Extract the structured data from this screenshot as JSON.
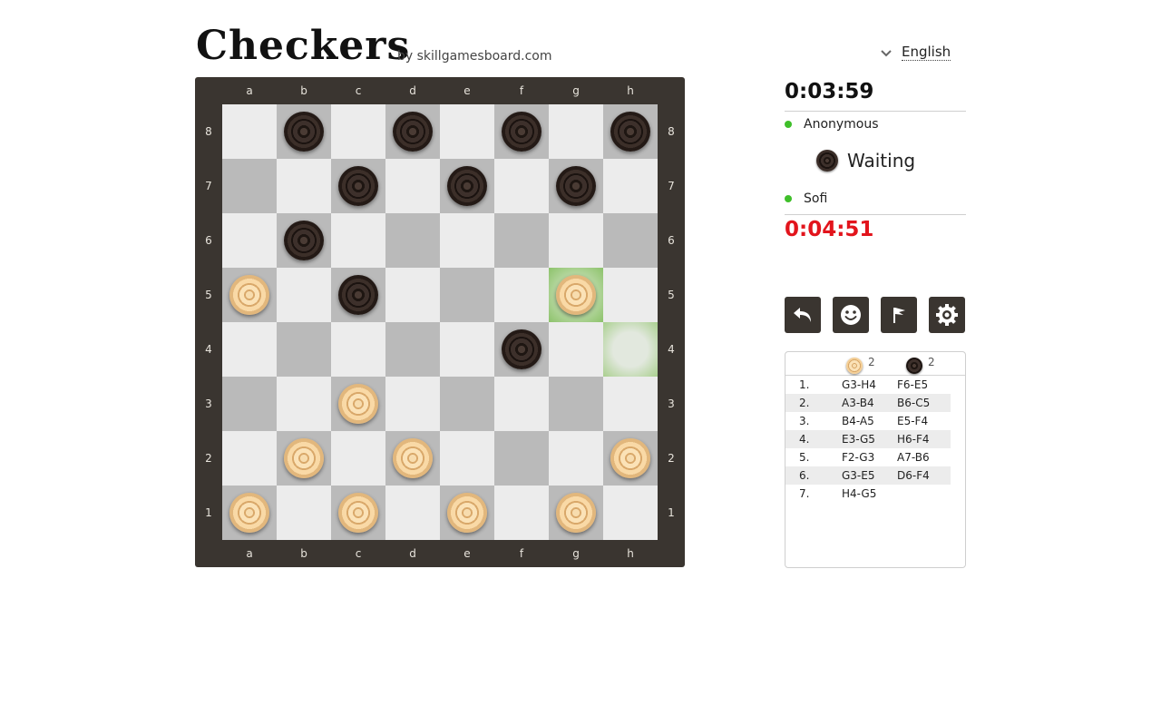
{
  "header": {
    "title": "Checkers",
    "byline": "by skillgamesboard.com",
    "language": "English"
  },
  "board": {
    "files": [
      "a",
      "b",
      "c",
      "d",
      "e",
      "f",
      "g",
      "h"
    ],
    "ranks": [
      "8",
      "7",
      "6",
      "5",
      "4",
      "3",
      "2",
      "1"
    ],
    "black_pieces": [
      "b8",
      "d8",
      "f8",
      "h8",
      "c7",
      "e7",
      "g7",
      "b6",
      "c5",
      "f4"
    ],
    "white_pieces": [
      "a5",
      "g5",
      "c3",
      "b2",
      "d2",
      "h2",
      "a1",
      "c1",
      "e1",
      "g1"
    ],
    "highlighted": [
      "g5",
      "h4"
    ]
  },
  "players": {
    "top": {
      "timer": "0:03:59",
      "name": "Anonymous",
      "status": "Waiting"
    },
    "bottom": {
      "timer": "0:04:51",
      "name": "Sofi"
    }
  },
  "colors": {
    "timer_low": "#e2141c",
    "online": "#3fbf2a",
    "panel_dark": "#3a3530"
  },
  "controls": [
    {
      "icon": "undo-icon"
    },
    {
      "icon": "smiley-icon"
    },
    {
      "icon": "flag-icon"
    },
    {
      "icon": "gear-icon"
    }
  ],
  "score": {
    "white": "2",
    "black": "2"
  },
  "moves": [
    {
      "num": "1.",
      "white": "G3-H4",
      "black": "F6-E5"
    },
    {
      "num": "2.",
      "white": "A3-B4",
      "black": "B6-C5"
    },
    {
      "num": "3.",
      "white": "B4-A5",
      "black": "E5-F4"
    },
    {
      "num": "4.",
      "white": "E3-G5",
      "black": "H6-F4"
    },
    {
      "num": "5.",
      "white": "F2-G3",
      "black": "A7-B6"
    },
    {
      "num": "6.",
      "white": "G3-E5",
      "black": "D6-F4"
    },
    {
      "num": "7.",
      "white": "H4-G5",
      "black": ""
    }
  ]
}
